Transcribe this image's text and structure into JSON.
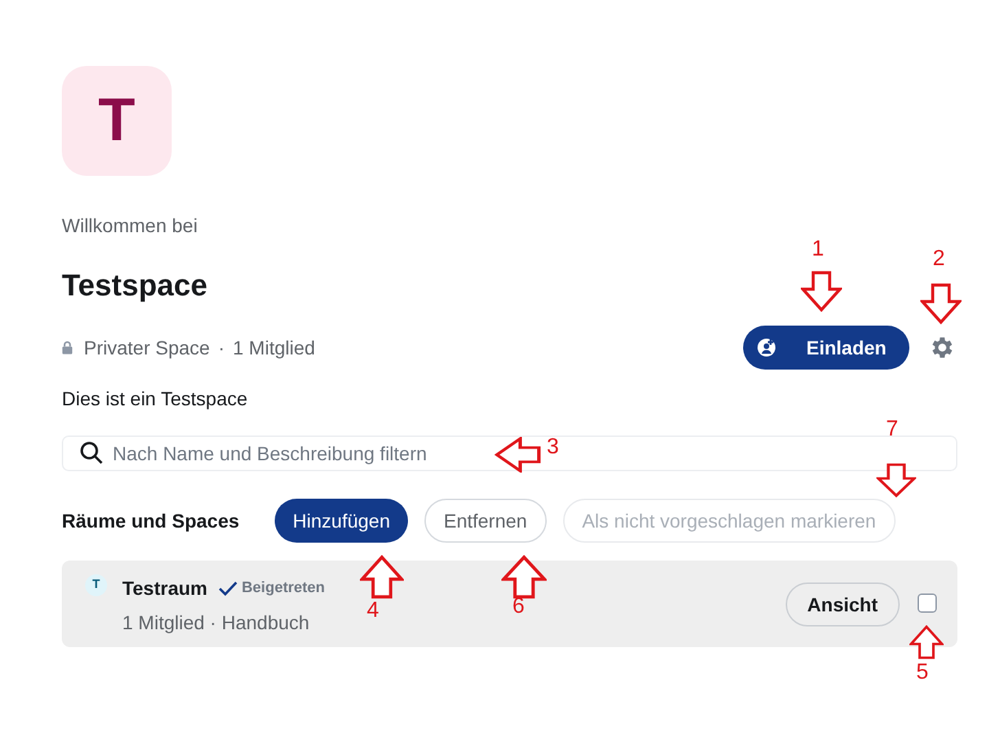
{
  "space": {
    "avatar_letter": "T",
    "welcome": "Willkommen bei",
    "name": "Testspace",
    "visibility": "Privater Space",
    "members": "1 Mitglied",
    "separator": "·",
    "description": "Dies ist ein Testspace"
  },
  "actions": {
    "invite": "Einladen"
  },
  "search": {
    "placeholder": "Nach Name und Beschreibung filtern"
  },
  "section": {
    "title": "Räume und Spaces"
  },
  "buttons": [
    {
      "label": "Hinzufügen",
      "kind": "primary",
      "disabled": false
    },
    {
      "label": "Entfernen",
      "kind": "outline",
      "disabled": false
    },
    {
      "label": "Als nicht vorgeschlagen markieren",
      "kind": "outline",
      "disabled": true
    }
  ],
  "rooms": [
    {
      "avatar_letter": "T",
      "name": "Testraum",
      "joined": true,
      "joined_label": "Beigetreten",
      "details": "1 Mitglied · Handbuch",
      "view": "Ansicht",
      "checked": false
    }
  ],
  "annotations": [
    {
      "number": "1",
      "kind": "down"
    },
    {
      "number": "2",
      "kind": "down"
    },
    {
      "number": "3",
      "kind": "left"
    },
    {
      "number": "4",
      "kind": "up"
    },
    {
      "number": "5",
      "kind": "up"
    },
    {
      "number": "6",
      "kind": "up"
    },
    {
      "number": "7",
      "kind": "down"
    }
  ]
}
